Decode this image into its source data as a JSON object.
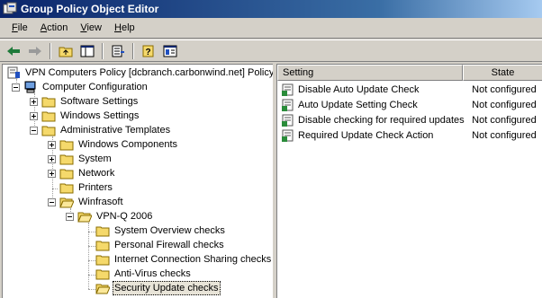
{
  "window": {
    "title": "Group Policy Object Editor"
  },
  "menu": [
    {
      "accel": "F",
      "rest": "ile"
    },
    {
      "accel": "A",
      "rest": "ction"
    },
    {
      "accel": "V",
      "rest": "iew"
    },
    {
      "accel": "H",
      "rest": "elp"
    }
  ],
  "tree": {
    "root": "VPN Computers Policy [dcbranch.carbonwind.net] Policy",
    "computer_configuration": "Computer Configuration",
    "software_settings": "Software Settings",
    "windows_settings": "Windows Settings",
    "administrative_templates": "Administrative Templates",
    "windows_components": "Windows Components",
    "system": "System",
    "network": "Network",
    "printers": "Printers",
    "winfrasoft": "Winfrasoft",
    "vpn_q_2006": "VPN-Q 2006",
    "system_overview_checks": "System Overview checks",
    "personal_firewall_checks": "Personal Firewall checks",
    "ics_checks": "Internet Connection Sharing checks",
    "antivirus_checks": "Anti-Virus checks",
    "security_update_checks": "Security Update checks"
  },
  "list": {
    "columns": {
      "setting": "Setting",
      "state": "State"
    },
    "rows": [
      {
        "setting": "Disable Auto Update Check",
        "state": "Not configured"
      },
      {
        "setting": "Auto Update Setting Check",
        "state": "Not configured"
      },
      {
        "setting": "Disable checking for required updates",
        "state": "Not configured"
      },
      {
        "setting": "Required Update Check Action",
        "state": "Not configured"
      }
    ]
  },
  "colors": {
    "titlebar": "#0a246a",
    "folder": "#f5d96b",
    "window_bg": "#d4d0c8"
  }
}
